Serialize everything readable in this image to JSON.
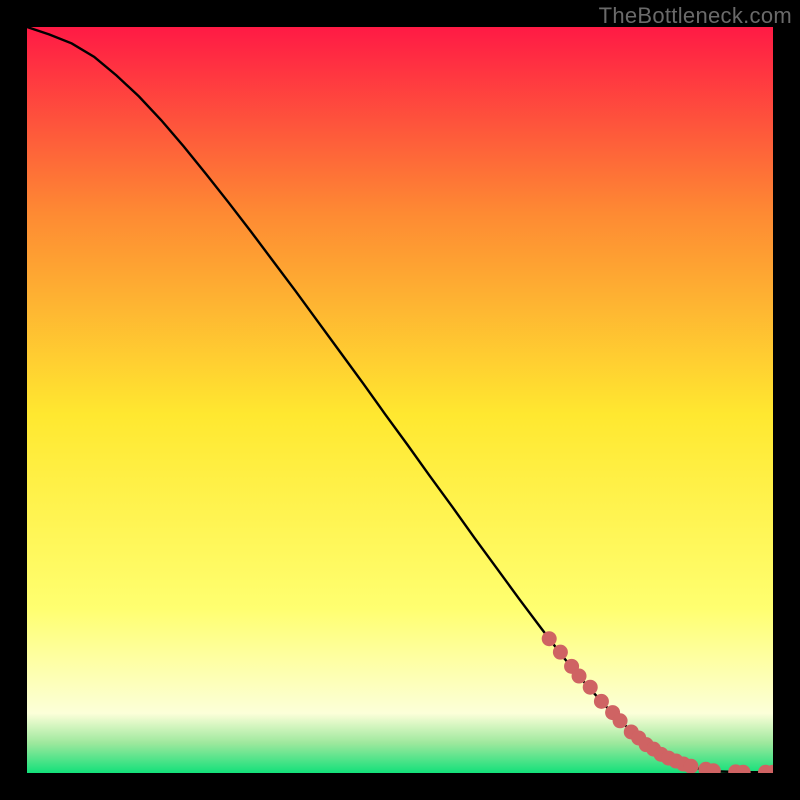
{
  "watermark": "TheBottleneck.com",
  "colors": {
    "frame": "#000000",
    "watermark": "#6a6a6a",
    "curve": "#000000",
    "dots": "#cf6363",
    "gradient_top": "#ff1a45",
    "gradient_mid_upper": "#fe8a33",
    "gradient_mid": "#ffe830",
    "gradient_mid_lower": "#ffff70",
    "gradient_lower": "#fcffd9",
    "gradient_green_top": "#9de89d",
    "gradient_green": "#13e07a"
  },
  "chart_data": {
    "type": "line",
    "title": "",
    "xlabel": "",
    "ylabel": "",
    "xlim": [
      0,
      100
    ],
    "ylim": [
      0,
      100
    ],
    "series": [
      {
        "name": "curve",
        "x": [
          0,
          3,
          6,
          9,
          12,
          15,
          18,
          21,
          24,
          27,
          30,
          33,
          36,
          39,
          42,
          45,
          48,
          51,
          54,
          57,
          60,
          63,
          66,
          69,
          72,
          75,
          78,
          81,
          84,
          87,
          90,
          93,
          96,
          100
        ],
        "y": [
          100,
          99,
          97.8,
          96,
          93.5,
          90.7,
          87.5,
          84,
          80.3,
          76.5,
          72.6,
          68.6,
          64.6,
          60.5,
          56.4,
          52.3,
          48.1,
          44,
          39.8,
          35.7,
          31.5,
          27.4,
          23.3,
          19.3,
          15.4,
          11.8,
          8.5,
          5.6,
          3.3,
          1.6,
          0.6,
          0.2,
          0.1,
          0.1
        ]
      },
      {
        "name": "dots",
        "x": [
          70,
          71.5,
          73,
          74,
          75.5,
          77,
          78.5,
          79.5,
          81,
          82,
          83,
          84,
          85,
          86,
          87,
          88,
          89,
          91,
          92,
          95,
          96,
          99,
          100
        ],
        "y": [
          18,
          16.2,
          14.3,
          13,
          11.5,
          9.6,
          8.1,
          7,
          5.5,
          4.7,
          3.8,
          3.2,
          2.5,
          2,
          1.6,
          1.2,
          0.9,
          0.5,
          0.3,
          0.15,
          0.1,
          0.1,
          0.1
        ]
      }
    ]
  }
}
